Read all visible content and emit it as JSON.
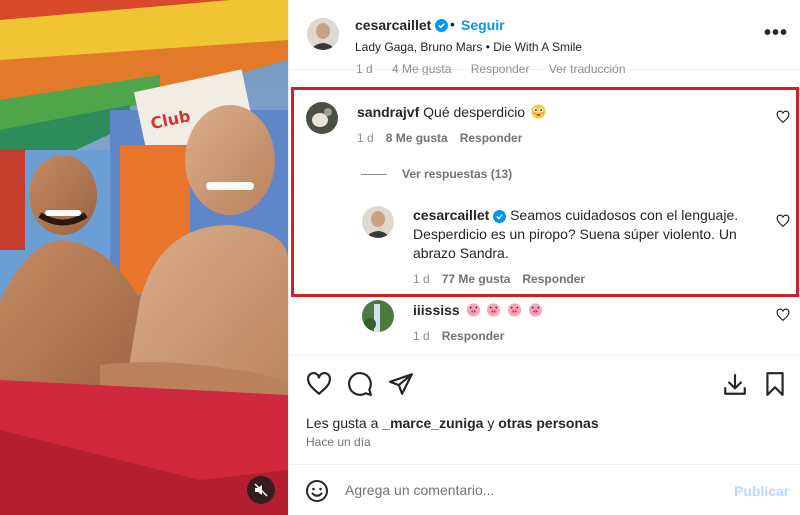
{
  "header": {
    "username": "cesarcaillet",
    "separator": "•",
    "follow_label": "Seguir",
    "song": "Lady Gaga, Bruno Mars • Die With A Smile",
    "more_label": "•••"
  },
  "previous_comment_peek": {
    "time": "1 d",
    "likes": "4 Me gusta",
    "reply": "Responder",
    "translation": "Ver traducción"
  },
  "comments": [
    {
      "username": "sandrajvf",
      "text": "Qué desperdicio",
      "emoji": "flushed-face",
      "time": "1 d",
      "likes": "8 Me gusta",
      "reply": "Responder",
      "view_replies": "Ver respuestas (13)"
    },
    {
      "username": "cesarcaillet",
      "verified": true,
      "line1": "Seamos cuidadosos con el lenguaje.",
      "line2": "Desperdicio es un piropo? Suena súper violento. Un",
      "line3": "abrazo Sandra.",
      "time": "1 d",
      "likes": "77 Me gusta",
      "reply": "Responder"
    },
    {
      "username": "iiississ",
      "emoji": "pig-face x4",
      "time": "1 d",
      "reply": "Responder"
    }
  ],
  "actions": {
    "likes_prefix": "Les gusta a",
    "likes_user": "_marce_zuniga",
    "likes_joiner": "y",
    "likes_others": "otras personas",
    "posted_ago": "Hace un día"
  },
  "composer": {
    "placeholder": "Agrega un comentario...",
    "publish_label": "Publicar"
  },
  "colors": {
    "accent": "#0095f6",
    "highlight_border": "#d0202a",
    "publish_disabled": "#b3dbff"
  }
}
